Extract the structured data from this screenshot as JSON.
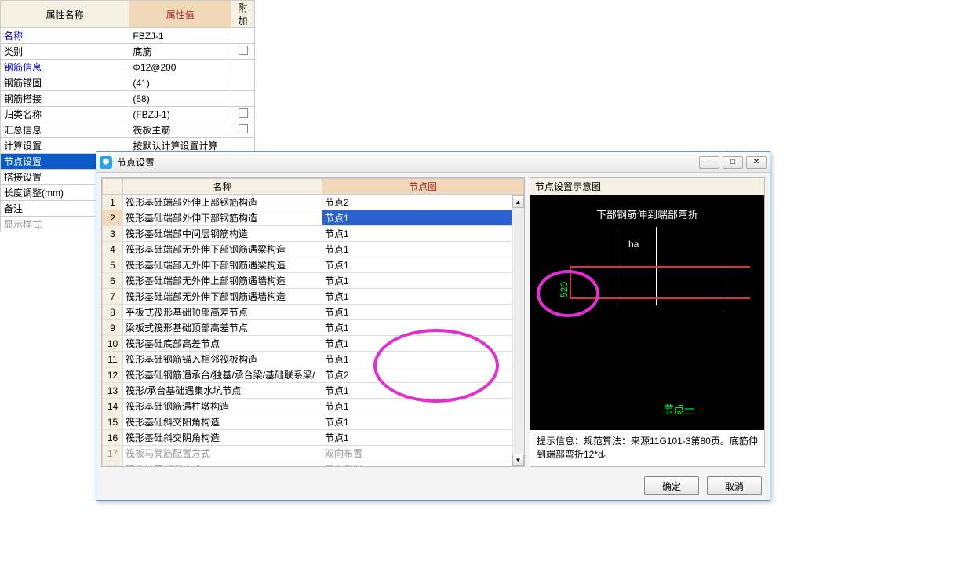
{
  "prop_headers": {
    "name": "属性名称",
    "value": "属性值",
    "extra": "附加"
  },
  "props": [
    {
      "name": "名称",
      "value": "FBZJ-1",
      "link": true,
      "chk": false
    },
    {
      "name": "类别",
      "value": "底筋",
      "chk": true
    },
    {
      "name": "钢筋信息",
      "value": "Φ12@200",
      "link": true,
      "chk": false
    },
    {
      "name": "钢筋锚固",
      "value": "(41)",
      "chk": false
    },
    {
      "name": "钢筋搭接",
      "value": "(58)",
      "chk": false
    },
    {
      "name": "归类名称",
      "value": "(FBZJ-1)",
      "chk": true
    },
    {
      "name": "汇总信息",
      "value": "筏板主筋",
      "chk": true
    },
    {
      "name": "计算设置",
      "value": "按默认计算设置计算",
      "chk": false
    },
    {
      "name": "节点设置",
      "value": "",
      "selected": true
    },
    {
      "name": "搭接设置",
      "value": ""
    },
    {
      "name": "长度调整(mm)",
      "value": "",
      "chk": true
    },
    {
      "name": "备注",
      "value": "",
      "chk": true
    },
    {
      "name": "显示样式",
      "value": "",
      "gray": true
    }
  ],
  "dialog": {
    "title": "节点设置",
    "headers": {
      "name": "名称",
      "diag": "节点图"
    },
    "rows": [
      {
        "n": 1,
        "name": "筏形基础端部外伸上部钢筋构造",
        "diag": "节点2"
      },
      {
        "n": 2,
        "name": "筏形基础端部外伸下部钢筋构造",
        "diag": "节点1",
        "sel": true
      },
      {
        "n": 3,
        "name": "筏形基础端部中间层钢筋构造",
        "diag": "节点1"
      },
      {
        "n": 4,
        "name": "筏形基础端部无外伸下部钢筋遇梁构造",
        "diag": "节点1"
      },
      {
        "n": 5,
        "name": "筏形基础端部无外伸下部钢筋遇梁构造",
        "diag": "节点1"
      },
      {
        "n": 6,
        "name": "筏形基础端部无外伸上部钢筋遇墙构造",
        "diag": "节点1"
      },
      {
        "n": 7,
        "name": "筏形基础端部无外伸下部钢筋遇墙构造",
        "diag": "节点1"
      },
      {
        "n": 8,
        "name": "平板式筏形基础顶部高差节点",
        "diag": "节点1"
      },
      {
        "n": 9,
        "name": "梁板式筏形基础顶部高差节点",
        "diag": "节点1"
      },
      {
        "n": 10,
        "name": "筏形基础底部高差节点",
        "diag": "节点1"
      },
      {
        "n": 11,
        "name": "筏形基础钢筋锚入相邻筏板构造",
        "diag": "节点1"
      },
      {
        "n": 12,
        "name": "筏形基础钢筋遇承台/独基/承台梁/基础联系梁/",
        "diag": "节点2"
      },
      {
        "n": 13,
        "name": "筏形/承台基础遇集水坑节点",
        "diag": "节点1"
      },
      {
        "n": 14,
        "name": "筏形基础钢筋遇柱墩构造",
        "diag": "节点1"
      },
      {
        "n": 15,
        "name": "筏形基础斜交阳角构造",
        "diag": "节点1"
      },
      {
        "n": 16,
        "name": "筏形基础斜交阴角构造",
        "diag": "节点1"
      },
      {
        "n": 17,
        "name": "筏板马凳筋配置方式",
        "diag": "双向布置",
        "dim": true
      },
      {
        "n": 18,
        "name": "筏板拉筋配置方式",
        "diag": "双向布置",
        "dim": true
      }
    ],
    "preview": {
      "title": "节点设置示意图",
      "caption": "下部钢筋伸到端部弯折",
      "ha": "ha",
      "dim": "520",
      "link": "节点一"
    },
    "hint_label": "提示信息：",
    "hint_text": "规范算法：来源11G101-3第80页。底筋伸到端部弯折12*d。",
    "ok": "确定",
    "cancel": "取消"
  }
}
